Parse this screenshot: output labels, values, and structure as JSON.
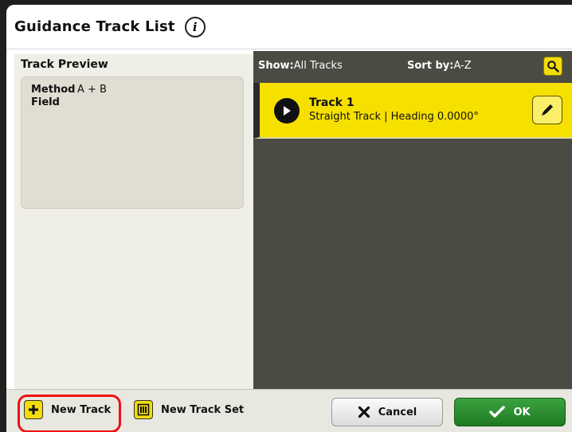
{
  "window": {
    "title": "Guidance Track List"
  },
  "left": {
    "header": "Track Preview",
    "preview": [
      {
        "label": "Method",
        "value": "A + B"
      },
      {
        "label": "Field",
        "value": ""
      }
    ]
  },
  "right": {
    "show_label": "Show:",
    "show_value": "All Tracks",
    "sort_label": "Sort by:",
    "sort_value": "A-Z",
    "tracks": [
      {
        "name": "Track 1",
        "description": "Straight Track | Heading 0.0000°"
      }
    ]
  },
  "bottom": {
    "new_track": "New Track",
    "new_track_set": "New Track Set",
    "cancel": "Cancel",
    "ok": "OK"
  },
  "colors": {
    "accent_yellow": "#f6e000",
    "ok_green": "#2a8f2f",
    "panel_dark": "#4a4b43",
    "highlight_red": "#e11111"
  },
  "icons": {
    "info": "info-icon",
    "search": "search-icon",
    "play": "play-arrow-icon",
    "edit": "pencil-icon",
    "add": "plus-icon",
    "track_set": "track-set-icon",
    "cancel": "x-icon",
    "ok": "checkmark-icon"
  }
}
